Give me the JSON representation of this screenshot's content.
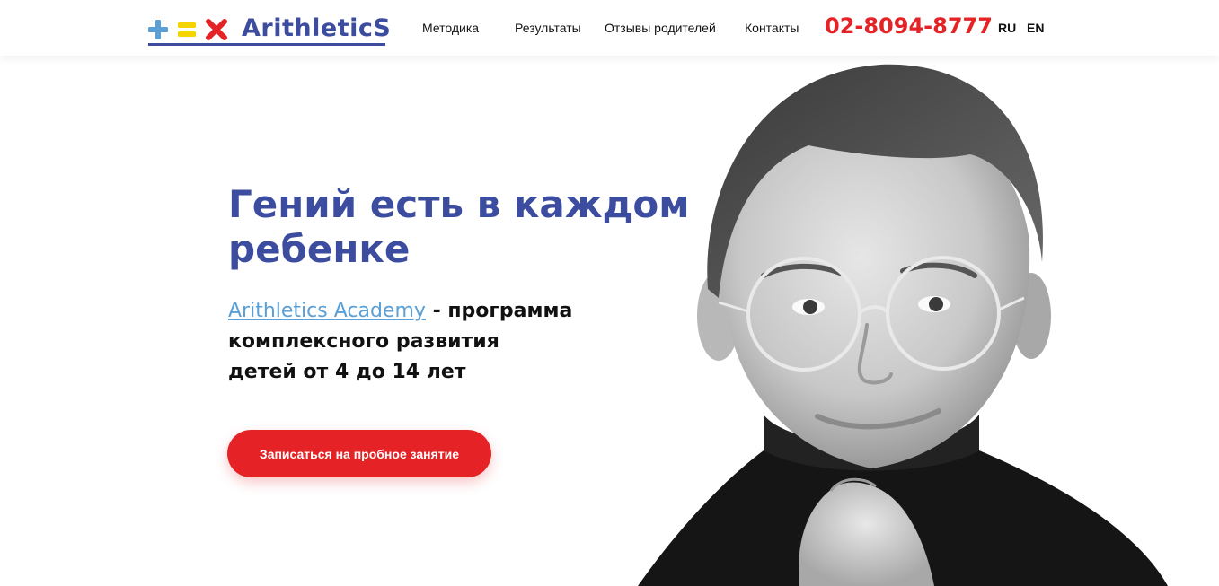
{
  "header": {
    "logo_text": "ArithleticS",
    "nav": [
      {
        "label": "Методика"
      },
      {
        "label": "Результаты"
      },
      {
        "label": "Отзывы родителей"
      },
      {
        "label": "Контакты"
      }
    ],
    "phone": "02-8094-8777",
    "languages": [
      "RU",
      "EN"
    ]
  },
  "hero": {
    "title_line1": "Гений есть в каждом",
    "title_line2": "ребенке",
    "link_text": "Arithletics Academy",
    "desc_line1": " - программа",
    "desc_line2": "комплексного развития",
    "desc_line3": "детей от 4 до 14 лет",
    "cta_label": "Записаться на пробное занятие"
  },
  "colors": {
    "brand_blue": "#3c4da0",
    "accent_red": "#e52327",
    "link_blue": "#5aa0d6",
    "logo_plus": "#5aa0d6",
    "logo_equals": "#f5d400",
    "logo_times": "#e52327"
  },
  "icons": {
    "logo_plus": "plus-icon",
    "logo_equals": "equals-icon",
    "logo_times": "times-icon"
  }
}
